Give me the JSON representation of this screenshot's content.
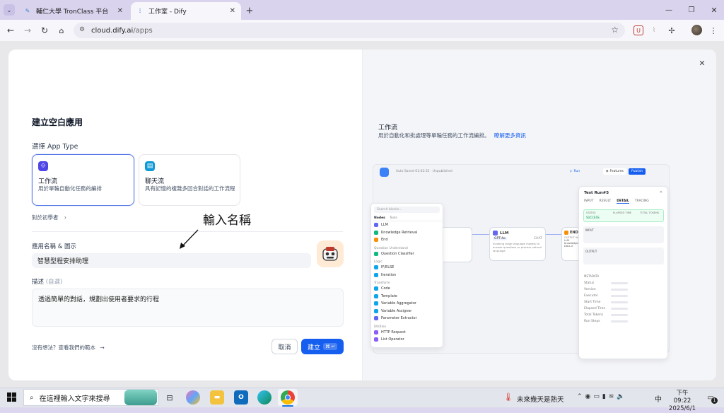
{
  "browser": {
    "tabs": [
      {
        "title": "輔仁大學 TronClass 平台",
        "active": false
      },
      {
        "title": "工作室 - Dify",
        "active": true
      }
    ],
    "url_host": "cloud.dify.ai",
    "url_path": "/apps"
  },
  "dialog": {
    "title": "建立空白應用",
    "app_type_label": "選擇 App Type",
    "types": [
      {
        "name": "工作流",
        "desc": "用於單輪自動化任務的編排",
        "selected": true
      },
      {
        "name": "聊天流",
        "desc": "具有記憶的複雜多回合對話的工作流程",
        "selected": false
      }
    ],
    "beginner_link": "對於初學者",
    "annotation": "輸入名稱",
    "name_label": "應用名稱 & 圖示",
    "name_value": "智慧型程安排助理",
    "desc_label": "描述",
    "desc_optional": "(自選)",
    "desc_value": "透過簡單的對話，規劃出使用者要求的行程",
    "template_link": "沒有想法？查看我們的範本",
    "cancel": "取消",
    "create": "建立",
    "create_shortcut": "⌘ ↵"
  },
  "preview": {
    "title": "工作流",
    "desc": "用於自動化和批處理等單輪任務的工作流編排。",
    "learn_more": "瞭解更多資訊",
    "mock": {
      "app_name": "Auto Saved 01:02:35 · Unpublished",
      "run": "Run",
      "features": "Features",
      "publish": "Publish",
      "search": "Search blocks...",
      "tabs": [
        "Nodes",
        "Tools"
      ],
      "groups": [
        {
          "head": "",
          "items": [
            "LLM",
            "Knowledge Retrieval",
            "End"
          ]
        },
        {
          "head": "Question Understand",
          "items": [
            "Question Classifier"
          ]
        },
        {
          "head": "Logic",
          "items": [
            "IF/ELSE",
            "Iteration"
          ]
        },
        {
          "head": "Transform",
          "items": [
            "Code",
            "Template",
            "Variable Aggregator",
            "Variable Assigner",
            "Parameter Extractor"
          ]
        },
        {
          "head": "Utilities",
          "items": [
            "HTTP Request",
            "List Operator"
          ]
        }
      ],
      "llm_node": "LLM",
      "llm_model": "GPT-4o",
      "llm_mode": "CHAT",
      "llm_text": "Invoking large language models to answer questions or process natural language",
      "end_node": "END",
      "end_vars": [
        "OUTPUT VARIABLE",
        "LLM",
        "Knowledge",
        "DALL-E"
      ],
      "panel_title": "Test Run#5",
      "panel_tabs": [
        "INPUT",
        "RESULT",
        "DETAIL",
        "TRACING"
      ],
      "status_heads": [
        "STATUS",
        "ELAPSED TIME",
        "TOTAL TOKENS"
      ],
      "status_value": "SUCCESS",
      "input_head": "INPUT",
      "output_head": "OUTPUT",
      "meta_head": "METADATA",
      "meta": [
        "Status",
        "Version",
        "Executor",
        "Start Time",
        "Elapsed Time",
        "Total Tokens",
        "Run Steps"
      ]
    }
  },
  "taskbar": {
    "search_placeholder": "在這裡輸入文字來搜尋",
    "weather": "未來幾天是熱天",
    "ime": "中",
    "time": "下午 09:22",
    "date": "2025/6/1",
    "notif_count": "1"
  },
  "colors": {
    "accent": "#155eef",
    "selected_border": "#5477e8"
  }
}
